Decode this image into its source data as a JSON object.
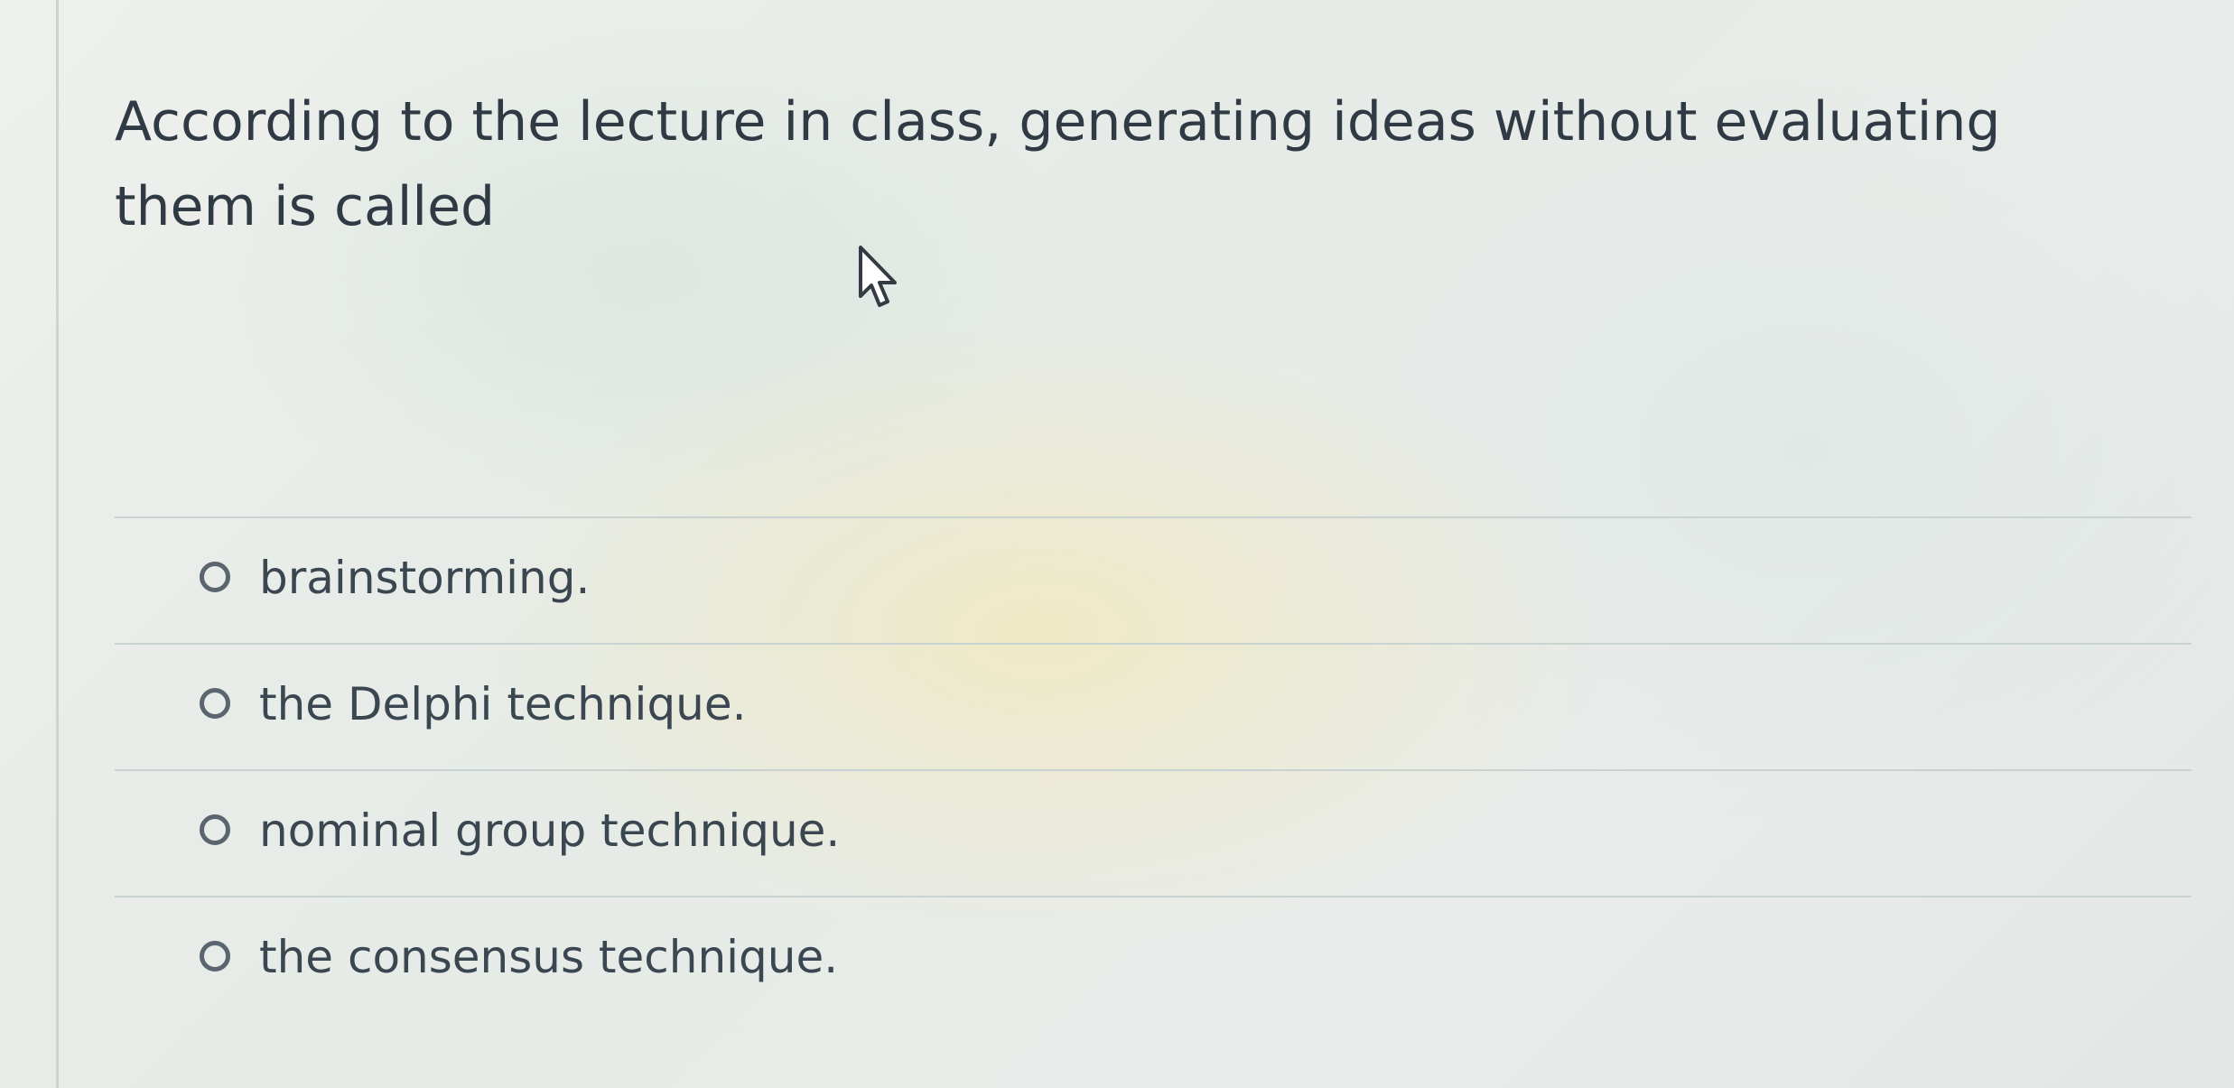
{
  "question": {
    "text": "According to the lecture in class, generating ideas without evaluating them is called"
  },
  "answers": [
    {
      "label": "brainstorming.",
      "selected": false
    },
    {
      "label": "the Delphi technique.",
      "selected": false
    },
    {
      "label": "nominal group technique.",
      "selected": false
    },
    {
      "label": "the consensus technique.",
      "selected": false
    }
  ],
  "icons": {
    "cursor": "mouse-pointer-icon",
    "radio": "radio-unchecked-icon"
  },
  "colors": {
    "text": "#2f3a44",
    "radio_border": "#5b6570",
    "divider": "#c9d3d2"
  }
}
